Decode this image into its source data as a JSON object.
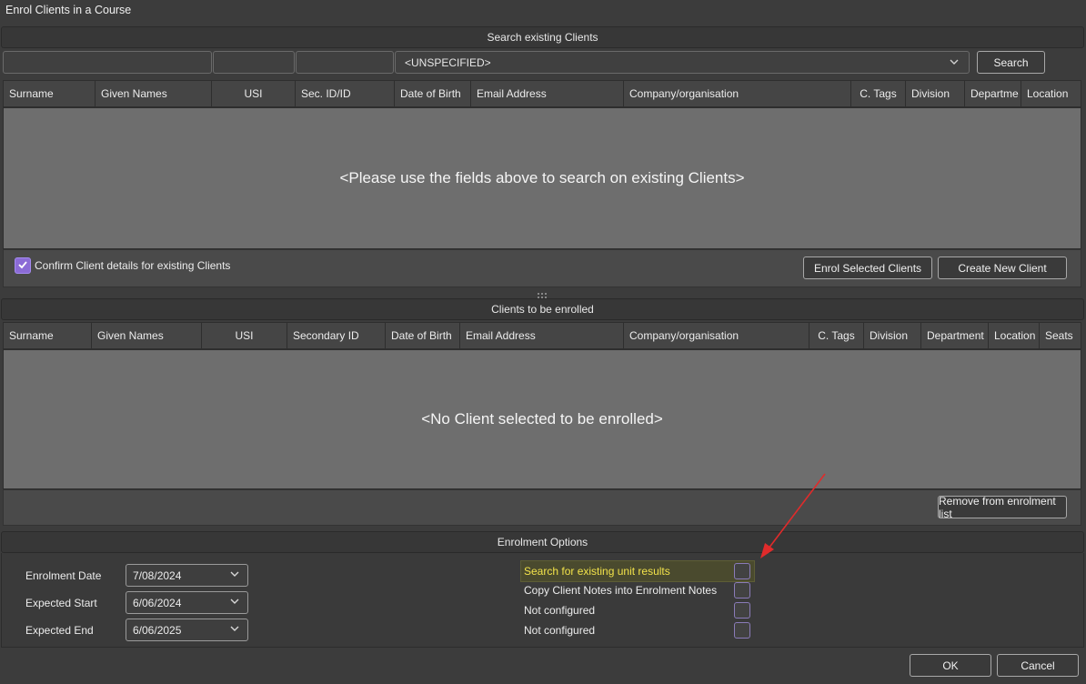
{
  "window": {
    "title": "Enrol Clients in a Course"
  },
  "search": {
    "header": "Search existing Clients",
    "filter_value": "<UNSPECIFIED>",
    "search_button": "Search",
    "columns": [
      "Surname",
      "Given Names",
      "USI",
      "Sec. ID/ID",
      "Date of Birth",
      "Email Address",
      "Company/organisation",
      "C. Tags",
      "Division",
      "Departme",
      "Location"
    ],
    "empty_message": "<Please use the fields above to search on existing Clients>",
    "confirm_label": "Confirm Client details for existing Clients",
    "confirm_checked": true,
    "enrol_button": "Enrol Selected Clients",
    "create_button": "Create New Client"
  },
  "enrolled": {
    "header": "Clients to be enrolled",
    "columns": [
      "Surname",
      "Given Names",
      "USI",
      "Secondary ID",
      "Date of Birth",
      "Email Address",
      "Company/organisation",
      "C. Tags",
      "Division",
      "Department",
      "Location",
      "Seats"
    ],
    "empty_message": "<No Client selected to be enrolled>",
    "remove_button": "Remove from enrolment list"
  },
  "options": {
    "header": "Enrolment Options",
    "dates": [
      {
        "label": "Enrolment Date",
        "value": "7/08/2024"
      },
      {
        "label": "Expected Start",
        "value": "6/06/2024"
      },
      {
        "label": "Expected End",
        "value": "6/06/2025"
      }
    ],
    "checks": [
      {
        "label": "Search for existing unit results",
        "checked": false,
        "highlighted": true
      },
      {
        "label": "Copy Client Notes into Enrolment Notes",
        "checked": false
      },
      {
        "label": "Not configured",
        "checked": false
      },
      {
        "label": "Not configured",
        "checked": false
      }
    ]
  },
  "footer": {
    "ok": "OK",
    "cancel": "Cancel"
  },
  "colors": {
    "highlight_text": "#f2e24a",
    "annotation_arrow": "#e02b2b",
    "checkbox_accent": "#8b6bd6"
  },
  "icons": {
    "chevron": "chevron-down-icon",
    "check": "check-icon",
    "splitter": "splitter-handle-icon"
  }
}
